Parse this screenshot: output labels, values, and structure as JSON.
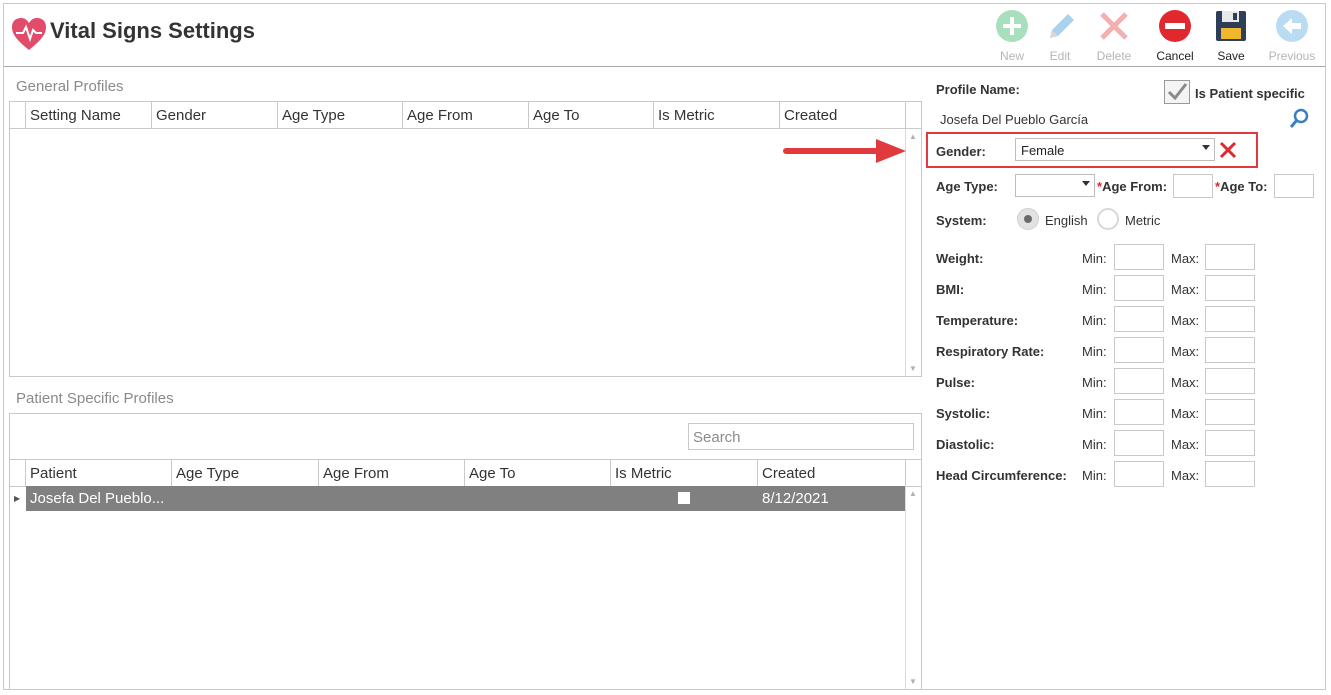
{
  "app": {
    "title": "Vital Signs Settings"
  },
  "toolbar": {
    "new": "New",
    "edit": "Edit",
    "delete": "Delete",
    "cancel": "Cancel",
    "save": "Save",
    "previous": "Previous"
  },
  "general_profiles": {
    "title": "General Profiles",
    "columns": [
      "Setting Name",
      "Gender",
      "Age Type",
      "Age From",
      "Age To",
      "Is Metric",
      "Created"
    ]
  },
  "patient_profiles": {
    "title": "Patient Specific Profiles",
    "search_placeholder": "Search",
    "columns": [
      "Patient",
      "Age Type",
      "Age From",
      "Age To",
      "Is Metric",
      "Created"
    ],
    "rows": [
      {
        "patient": "Josefa Del Pueblo...",
        "is_metric": false,
        "created": "8/12/2021"
      }
    ]
  },
  "form": {
    "profile_name_label": "Profile Name:",
    "profile_name_value": "Josefa Del Pueblo García",
    "is_patient_specific_label": "Is Patient specific",
    "gender_label": "Gender:",
    "gender_value": "Female",
    "age_type_label": "Age Type:",
    "age_from_label": "Age From:",
    "age_to_label": "Age To:",
    "required_mark": "*",
    "system_label": "System:",
    "english_label": "English",
    "metric_label": "Metric",
    "min_label": "Min:",
    "max_label": "Max:",
    "vitals": [
      "Weight:",
      "BMI:",
      "Temperature:",
      "Respiratory Rate:",
      "Pulse:",
      "Systolic:",
      "Diastolic:",
      "Head Circumference:"
    ]
  },
  "colors": {
    "accent_red": "#e0282e",
    "selected_row": "#808080",
    "disabled": "#b5b5b5"
  }
}
